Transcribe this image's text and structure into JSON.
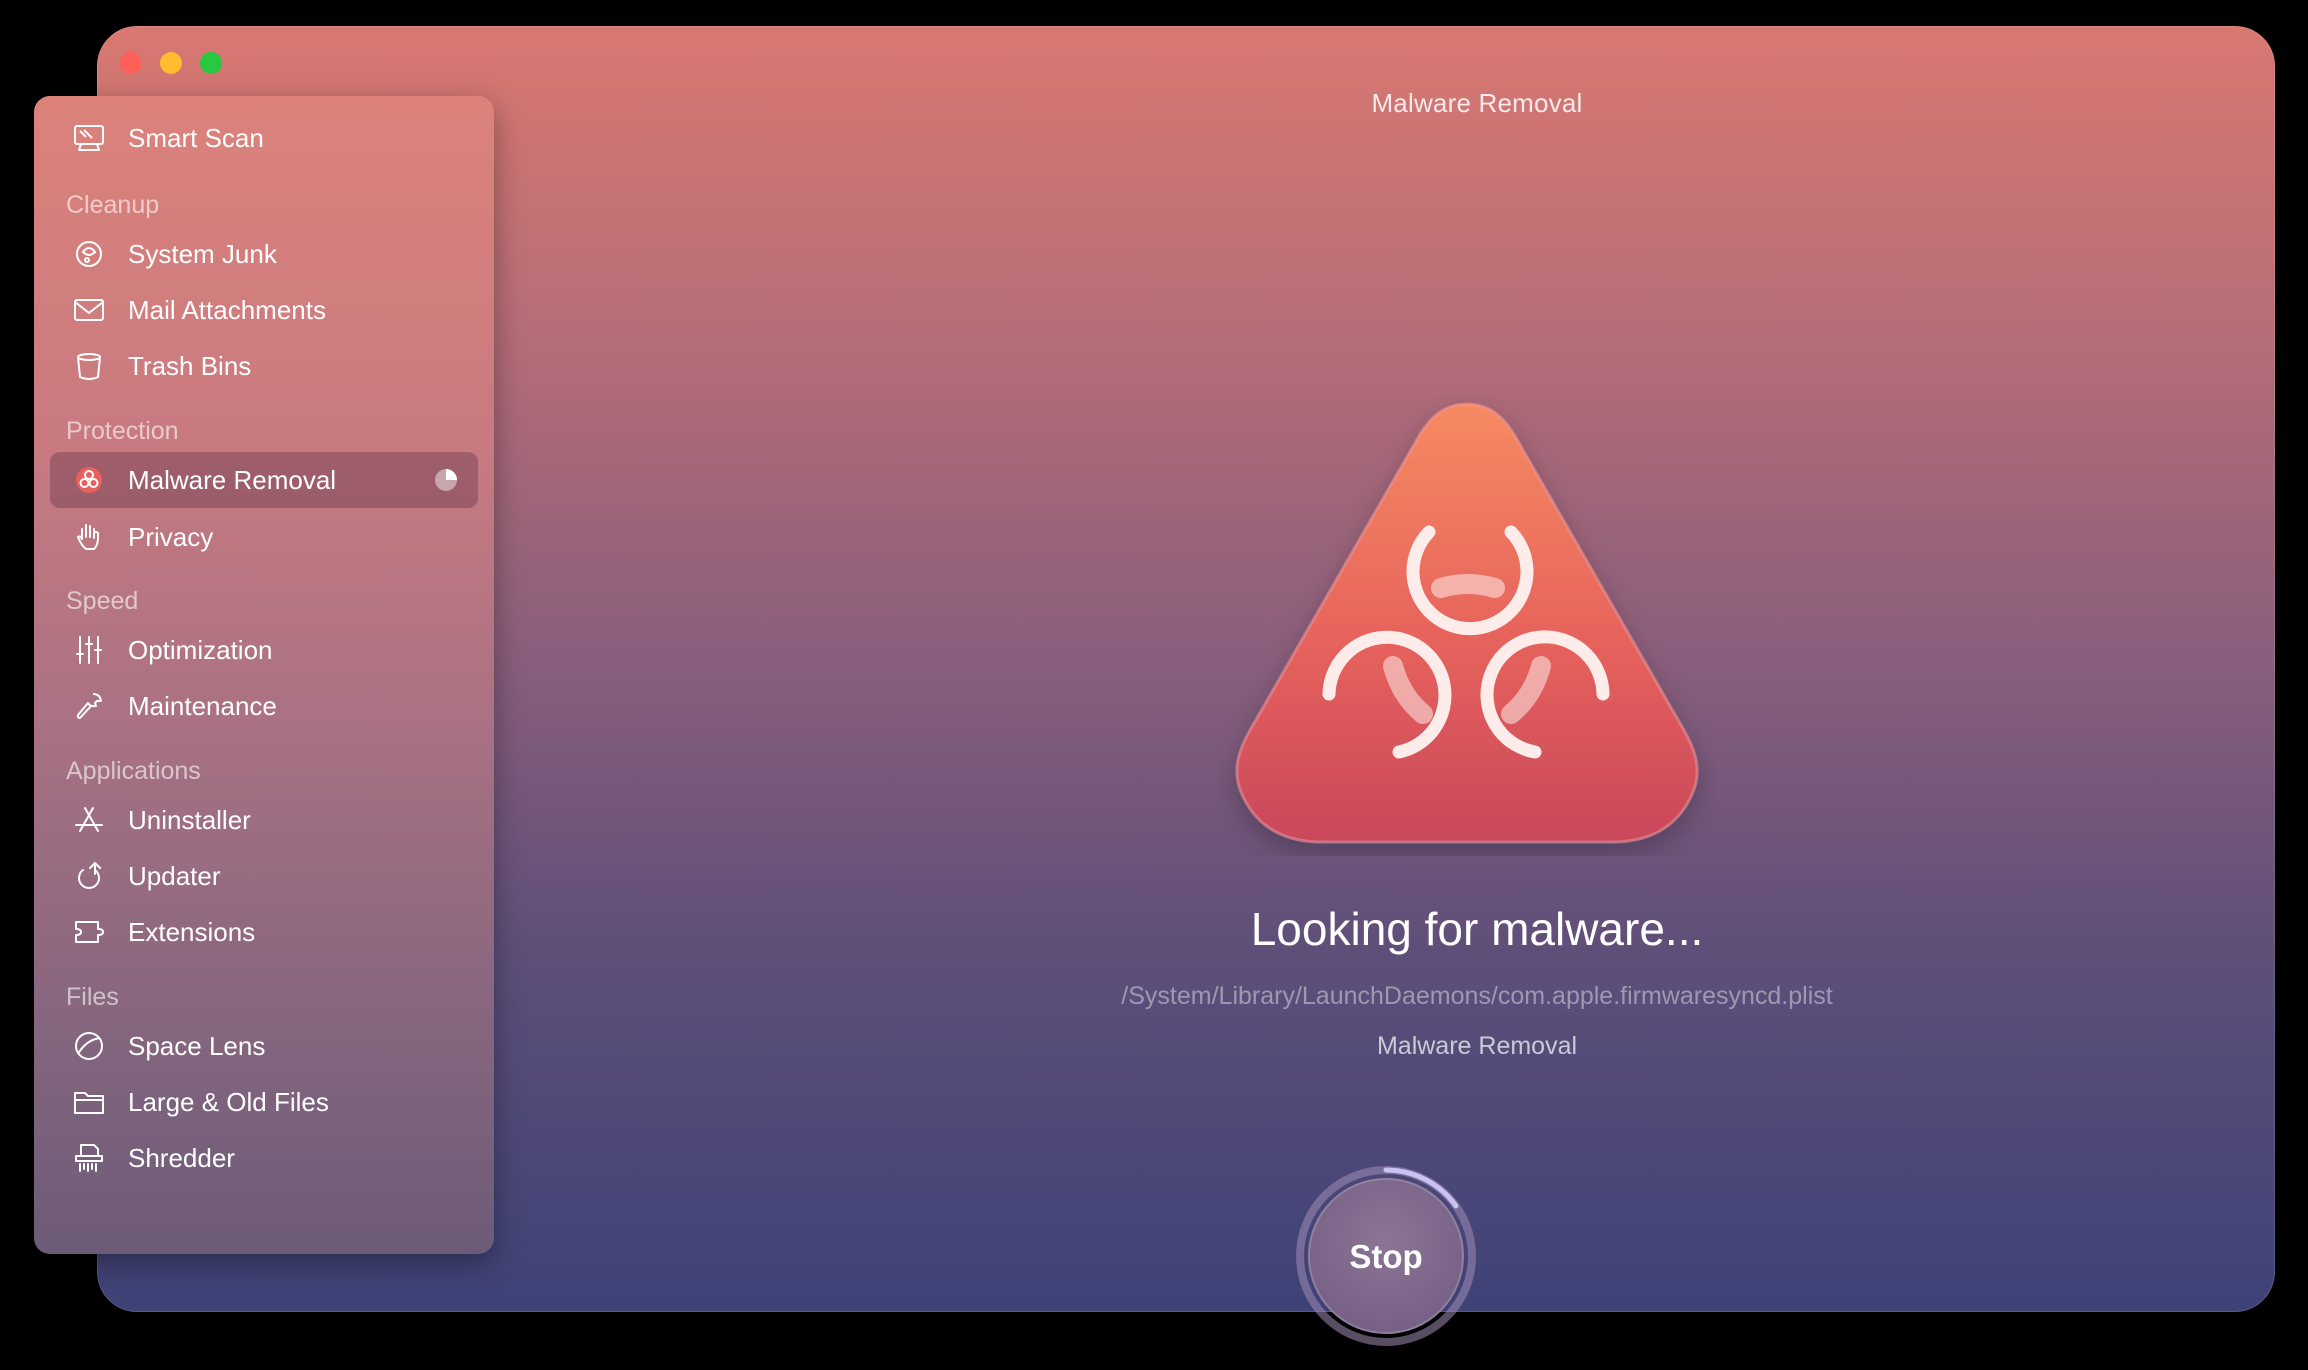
{
  "window": {
    "title": "Malware Removal"
  },
  "sidebar": {
    "smart_scan": "Smart Scan",
    "sections": {
      "cleanup": "Cleanup",
      "protection": "Protection",
      "speed": "Speed",
      "applications": "Applications",
      "files": "Files"
    },
    "items": {
      "system_junk": "System Junk",
      "mail_attachments": "Mail Attachments",
      "trash_bins": "Trash Bins",
      "malware_removal": "Malware Removal",
      "privacy": "Privacy",
      "optimization": "Optimization",
      "maintenance": "Maintenance",
      "uninstaller": "Uninstaller",
      "updater": "Updater",
      "extensions": "Extensions",
      "space_lens": "Space Lens",
      "large_old_files": "Large & Old Files",
      "shredder": "Shredder"
    },
    "active_item": "malware_removal"
  },
  "main": {
    "status_title": "Looking for malware...",
    "current_path": "/System/Library/LaunchDaemons/com.apple.firmwaresyncd.plist",
    "module_name": "Malware Removal",
    "stop_label": "Stop"
  },
  "colors": {
    "accent_red": "#e8605a",
    "window_top": "#d87871",
    "window_bottom": "#3e4277",
    "progress_ring": "#c9c2f2"
  },
  "icons": {
    "hero": "biohazard-triangle-icon",
    "assistant": "assistant-dots-icon"
  }
}
